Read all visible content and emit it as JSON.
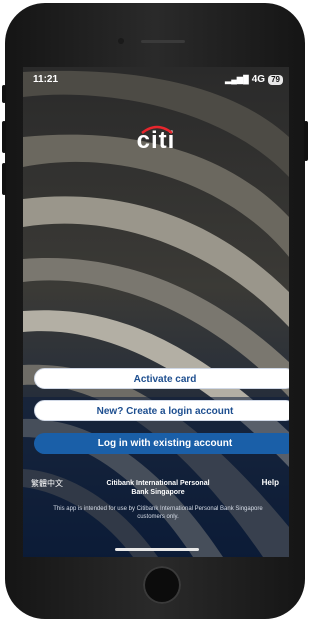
{
  "status_bar": {
    "time": "11:21",
    "network": "4G",
    "battery": "79"
  },
  "brand": {
    "logo_text": "citi"
  },
  "actions": {
    "activate_card": "Activate card",
    "create_account": "New? Create a login account",
    "login": "Log in with existing account"
  },
  "footer": {
    "language": "繁體中文",
    "entity": "Citibank International Personal Bank Singapore",
    "help": "Help",
    "disclaimer": "This app is intended for use by Citibank International Personal Bank Singapore customers only."
  },
  "colors": {
    "primary": "#1a5fa8",
    "button_text": "#1d4e8f",
    "background": "#0c1b2e"
  }
}
